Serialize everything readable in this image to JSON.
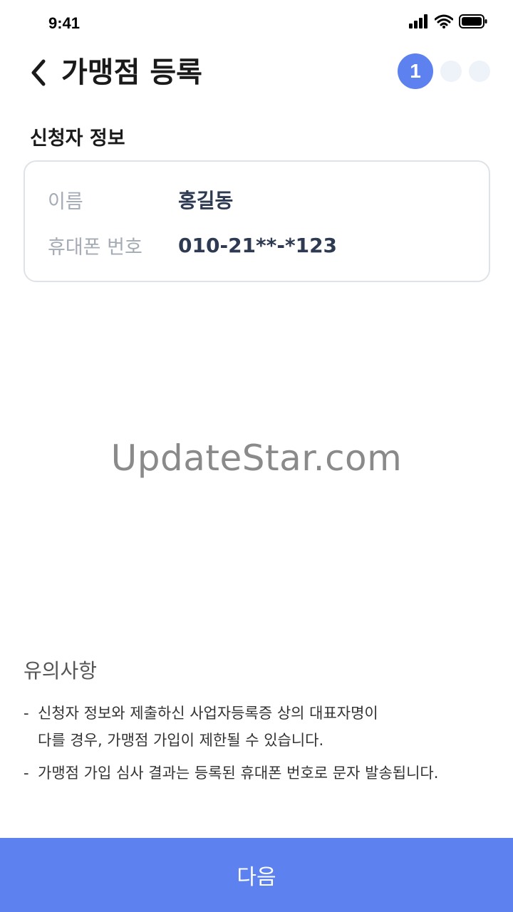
{
  "status_bar": {
    "time": "9:41",
    "icons": [
      "signal-icon",
      "wifi-icon",
      "battery-icon"
    ]
  },
  "header": {
    "title": "가맹점 등록",
    "back_icon": "chevron-left-icon",
    "steps": [
      {
        "label": "1",
        "active": true
      },
      {
        "label": "",
        "active": false
      },
      {
        "label": "",
        "active": false
      }
    ]
  },
  "applicant": {
    "section_title": "신청자 정보",
    "rows": [
      {
        "label": "이름",
        "value": "홍길동"
      },
      {
        "label": "휴대폰 번호",
        "value": "010-21**-*123"
      }
    ]
  },
  "watermark": "UpdateStar.com",
  "notice": {
    "title": "유의사항",
    "dash": "-",
    "items": [
      [
        "신청자 정보와 제출하신 사업자등록증 상의 대표자명이",
        "다를 경우, 가맹점 가입이 제한될 수 있습니다."
      ],
      [
        "가맹점 가입 심사 결과는 등록된 휴대폰 번호로 문자 발송됩니다."
      ]
    ]
  },
  "next_button": {
    "label": "다음"
  },
  "colors": {
    "accent": "#5d82f0",
    "step_inactive": "#eef2f9",
    "label_gray": "#a5abb4",
    "value_navy": "#2d3a52"
  }
}
